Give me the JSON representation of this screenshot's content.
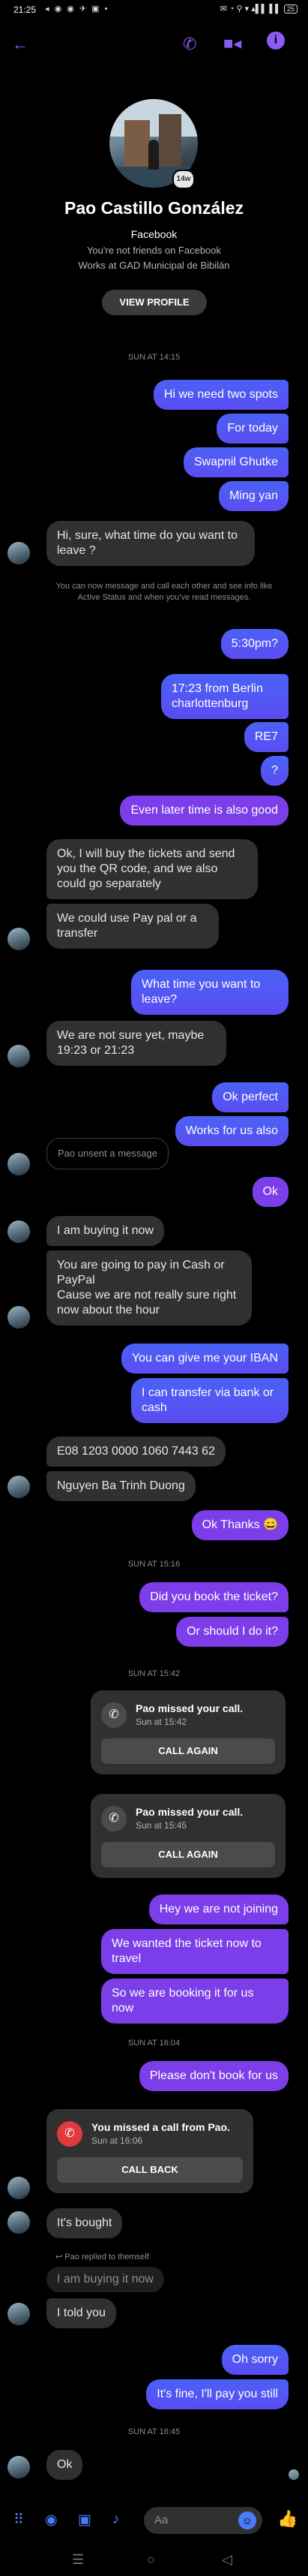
{
  "status_bar": {
    "time": "21:25",
    "left_icons": "◂ ◉ ◉ ✈ ▣ •",
    "right_icons": "✉ ◔ ⚲ ▾ ▴▌▌ ▌▌",
    "battery": "25"
  },
  "header": {
    "back_icon": "back-arrow-icon",
    "call_icon": "phone-icon",
    "video_icon": "video-icon",
    "info_icon": "info-icon",
    "accent": "#8b5cf6"
  },
  "profile": {
    "name": "Pao Castillo González",
    "source": "Facebook",
    "friend_status": "You're not friends on Facebook",
    "work": "Works at GAD Municipal de Bibilán",
    "badge": "14w",
    "view_profile_label": "VIEW PROFILE"
  },
  "timestamps": [
    "SUN AT 14:15",
    "SUN AT 15:16",
    "SUN AT 15:42",
    "SUN AT 16:04",
    "SUN AT 16:45"
  ],
  "system_note": "You can now message and call each other and see info like Active Status and when you've read messages.",
  "messages": {
    "m1": "Hi we need two spots",
    "m2": "For today",
    "m3": "Swapnil Ghutke",
    "m4": "Ming yan",
    "m5": "Hi, sure, what time do you want to leave ?",
    "m6": "5:30pm?",
    "m7": "17:23 from Berlin charlottenburg",
    "m8": "RE7",
    "m9": "?",
    "m10": "Even later time is also good",
    "m11": "Ok, I will buy the tickets and send you the QR code, and we also could go separately",
    "m12": "We could use Pay pal or a transfer",
    "m13": "What time you want to leave?",
    "m14": "We are not sure yet, maybe 19:23 or 21:23",
    "m15": "Ok perfect",
    "m16": "Works for us also",
    "m17": "Pao unsent a message",
    "m18": "Ok",
    "m19": "I am buying it now",
    "m20": "You are going to pay  in Cash or PayPal\nCause we are not really sure right now about the hour",
    "m21": "You can give me your IBAN",
    "m22": "I can transfer via bank or cash",
    "m23": "E08 1203 0000 1060 7443 62",
    "m24": "Nguyen Ba Trinh Duong",
    "m25": "Ok Thanks 😄",
    "m26": "Did you book the ticket?",
    "m27": "Or should I do it?",
    "m28": "Hey we are not joining",
    "m29": "We wanted the ticket now to travel",
    "m30": "So we are booking it for us now",
    "m31": "Please don't book for us",
    "m32": "It's bought",
    "m33": "I told you",
    "m34": "Oh sorry",
    "m35": "It's fine, I'll pay you still",
    "m36": "Ok"
  },
  "calls": [
    {
      "title": "Pao missed your call.",
      "when": "Sun at 15:42",
      "button": "CALL AGAIN"
    },
    {
      "title": "Pao missed your call.",
      "when": "Sun at 15:45",
      "button": "CALL AGAIN"
    },
    {
      "title": "You missed a call from Pao.",
      "when": "Sun at 16:06",
      "button": "CALL BACK"
    }
  ],
  "reply": {
    "note": "Pao replied to themself",
    "quoted": "I am buying it now"
  },
  "composer": {
    "placeholder": "Aa",
    "icons": [
      "grid-icon",
      "camera-icon",
      "image-icon",
      "microphone-icon",
      "emoji-icon",
      "like-icon"
    ],
    "accent": "#4a7cf7"
  },
  "colors": {
    "outgoing_blue": "#4a62f5",
    "outgoing_purple": "#7b3ee8",
    "incoming": "#303030",
    "missed_call_red": "#e0393e"
  }
}
